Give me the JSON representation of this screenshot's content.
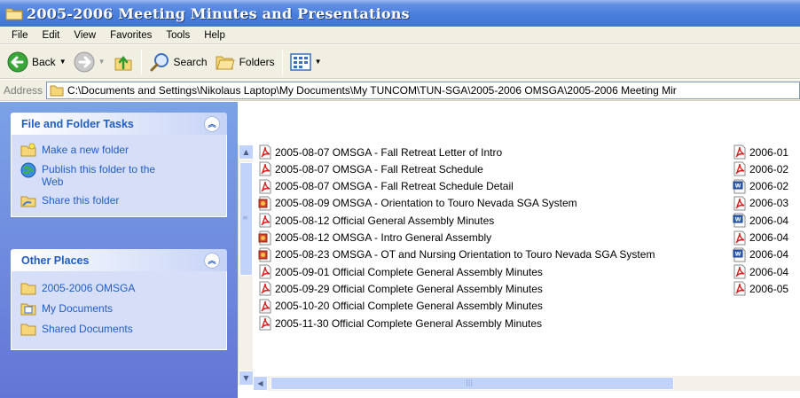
{
  "window": {
    "title": "2005-2006 Meeting Minutes and Presentations"
  },
  "menu": [
    "File",
    "Edit",
    "View",
    "Favorites",
    "Tools",
    "Help"
  ],
  "toolbar": {
    "back_label": "Back",
    "search_label": "Search",
    "folders_label": "Folders"
  },
  "address": {
    "label": "Address",
    "path": "C:\\Documents and Settings\\Nikolaus Laptop\\My Documents\\My TUNCOM\\TUN-SGA\\2005-2006 OMSGA\\2005-2006 Meeting Mir"
  },
  "taskpane": {
    "file_tasks": {
      "title": "File and Folder Tasks",
      "items": [
        {
          "label": "Make a new folder",
          "icon": "new-folder-icon"
        },
        {
          "label": "Publish this folder to the Web",
          "icon": "publish-web-icon"
        },
        {
          "label": "Share this folder",
          "icon": "share-folder-icon"
        }
      ]
    },
    "other_places": {
      "title": "Other Places",
      "items": [
        {
          "label": "2005-2006 OMSGA",
          "icon": "folder-icon"
        },
        {
          "label": "My Documents",
          "icon": "my-documents-icon"
        },
        {
          "label": "Shared Documents",
          "icon": "shared-documents-icon"
        }
      ]
    }
  },
  "files_col1": [
    {
      "name": "2005-08-07 OMSGA - Fall Retreat Letter of Intro",
      "type": "pdf"
    },
    {
      "name": "2005-08-07 OMSGA - Fall Retreat Schedule",
      "type": "pdf"
    },
    {
      "name": "2005-08-07 OMSGA - Fall Retreat Schedule Detail",
      "type": "pdf"
    },
    {
      "name": "2005-08-09 OMSGA - Orientation to Touro Nevada SGA System",
      "type": "ppt"
    },
    {
      "name": "2005-08-12 Official General Assembly Minutes",
      "type": "pdf"
    },
    {
      "name": "2005-08-12 OMSGA - Intro General Assembly",
      "type": "ppt"
    },
    {
      "name": "2005-08-23 OMSGA - OT and Nursing Orientation to Touro Nevada SGA System",
      "type": "ppt"
    },
    {
      "name": "2005-09-01 Official Complete General Assembly Minutes",
      "type": "pdf"
    },
    {
      "name": "2005-09-29 Official Complete General Assembly Minutes",
      "type": "pdf"
    },
    {
      "name": "2005-10-20 Official Complete General Assembly Minutes",
      "type": "pdf"
    },
    {
      "name": "2005-11-30 Official Complete General Assembly Minutes",
      "type": "pdf"
    }
  ],
  "files_col2": [
    {
      "name": "2006-01",
      "type": "pdf"
    },
    {
      "name": "2006-02",
      "type": "pdf"
    },
    {
      "name": "2006-02",
      "type": "doc"
    },
    {
      "name": "2006-03",
      "type": "pdf"
    },
    {
      "name": "2006-04",
      "type": "doc"
    },
    {
      "name": "2006-04",
      "type": "pdf"
    },
    {
      "name": "2006-04",
      "type": "doc"
    },
    {
      "name": "2006-04",
      "type": "pdf"
    },
    {
      "name": "2006-05",
      "type": "pdf"
    }
  ]
}
